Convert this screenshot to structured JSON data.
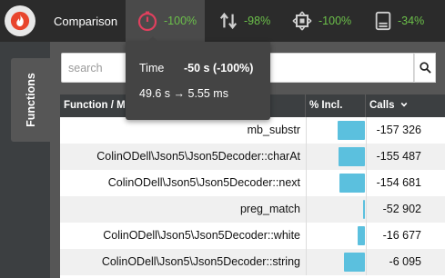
{
  "header": {
    "title": "Comparison",
    "logo_icon": "flame-icon",
    "metrics": [
      {
        "icon": "timer-icon",
        "value": "-100%",
        "active": true,
        "color": "#6cc04a"
      },
      {
        "icon": "arrows-up-down-icon",
        "value": "-98%",
        "color": "#6cc04a"
      },
      {
        "icon": "cpu-chip-icon",
        "value": "-100%",
        "color": "#6cc04a"
      },
      {
        "icon": "memory-icon",
        "value": "-34%",
        "color": "#6cc04a"
      }
    ]
  },
  "sidebar": {
    "tab_label": "Functions"
  },
  "search": {
    "placeholder": "search",
    "value": ""
  },
  "tooltip": {
    "label": "Time",
    "value": "-50 s (-100%)",
    "range": "49.6 s → 5.55 ms"
  },
  "table": {
    "columns": [
      {
        "label": "Function / M"
      },
      {
        "label": "% Incl."
      },
      {
        "label": "Calls"
      }
    ],
    "sort_icon": "chevron-down-icon",
    "rows": [
      {
        "function": "mb_substr",
        "incl_pct": 47,
        "calls": "-157 326"
      },
      {
        "function": "ColinODell\\Json5\\Json5Decoder::charAt",
        "incl_pct": 46,
        "calls": "-155 487"
      },
      {
        "function": "ColinODell\\Json5\\Json5Decoder::next",
        "incl_pct": 43,
        "calls": "-154 681"
      },
      {
        "function": "preg_match",
        "incl_pct": 3,
        "calls": "-52 902"
      },
      {
        "function": "ColinODell\\Json5\\Json5Decoder::white",
        "incl_pct": 12,
        "calls": "-16 677"
      },
      {
        "function": "ColinODell\\Json5\\Json5Decoder::string",
        "incl_pct": 36,
        "calls": "-6 095"
      }
    ]
  },
  "colors": {
    "accent_positive": "#6cc04a",
    "active_icon": "#e0405e",
    "bar": "#5bc0de",
    "logo": "#e8452c"
  }
}
